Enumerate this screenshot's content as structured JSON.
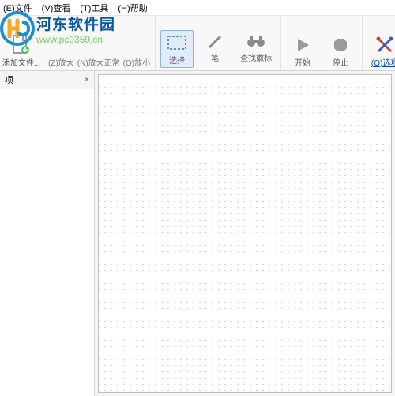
{
  "menubar": {
    "file": "(E)文件",
    "view": "(V)查看",
    "tools": "(T)工具",
    "help": "(H)帮助"
  },
  "watermark": {
    "title": "河东软件园",
    "url": "www.pc0359.cn"
  },
  "toolbar": {
    "addFile": "添加文件...",
    "zoomIn": "(Z)放大",
    "zoomNormal": "(N)放大正常",
    "zoomOut": "(O)放小",
    "select": "选择",
    "pen": "笔",
    "findBadge": "查找徽标",
    "start": "开始",
    "stop": "停止",
    "options": "(O)选项"
  },
  "sidepanel": {
    "tab": "项",
    "close": "×"
  }
}
